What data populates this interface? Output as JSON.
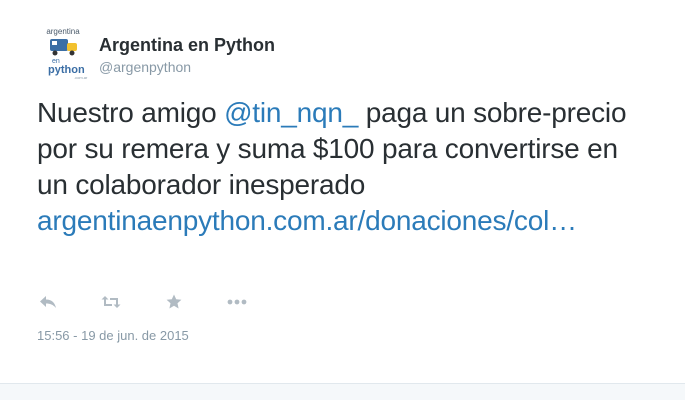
{
  "author": {
    "display_name": "Argentina en Python",
    "screen_name": "@argenpython",
    "avatar_icon": "argentina-en-python-logo",
    "avatar_lettering": {
      "top": "argentina",
      "middle": "en",
      "bottom": "python"
    }
  },
  "tweet": {
    "text_part1": "Nuestro amigo ",
    "mention": "@tin_nqn_",
    "text_part2": " paga un sobre-precio por su remera y suma $100 para convertirse en un colaborador inesperado ",
    "link": "argentinaenpython.com.ar/donaciones/col…"
  },
  "actions": [
    {
      "name": "reply",
      "icon": "reply-icon"
    },
    {
      "name": "retweet",
      "icon": "retweet-icon"
    },
    {
      "name": "favorite",
      "icon": "star-icon"
    },
    {
      "name": "more",
      "icon": "more-icon"
    }
  ],
  "timestamp": "15:56 - 19 de jun. de 2015",
  "colors": {
    "text": "#292f33",
    "muted": "#8899a6",
    "link": "#2b7bb9",
    "icon": "#b1bbc3"
  }
}
